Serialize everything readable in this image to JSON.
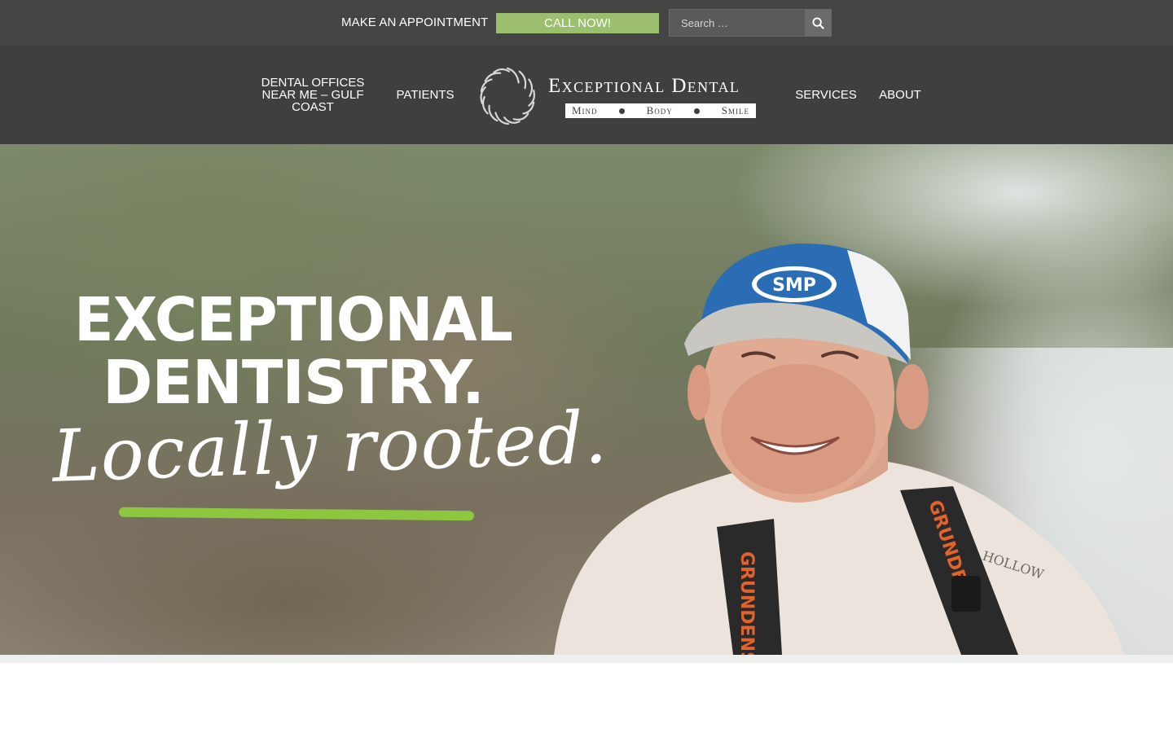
{
  "topbar": {
    "appointment_label": "MAKE AN APPOINTMENT",
    "call_label": "CALL NOW!",
    "search_placeholder": "Search …",
    "search_icon": "search-icon"
  },
  "nav": {
    "left": [
      {
        "label_lines": [
          "DENTAL OFFICES",
          "NEAR ME – GULF",
          "COAST"
        ]
      },
      {
        "label": "PATIENTS"
      }
    ],
    "right": [
      {
        "label": "SERVICES"
      },
      {
        "label": "ABOUT"
      }
    ]
  },
  "logo": {
    "name": "Exceptional Dental",
    "tagline_parts": [
      "Mind",
      "Body",
      "Smile"
    ]
  },
  "hero": {
    "headline_line1": "EXCEPTIONAL",
    "headline_line2": "DENTISTRY.",
    "tagline": "Locally rooted.",
    "cap_logo": "SMP",
    "suspender_text": "GRUNDENS",
    "shirt_text": "HOLLOW"
  },
  "colors": {
    "topbar_bg": "#454545",
    "navbar_bg": "#3f3f3f",
    "call_button": "#9bbf6e",
    "underline_accent": "#8dc63f"
  }
}
